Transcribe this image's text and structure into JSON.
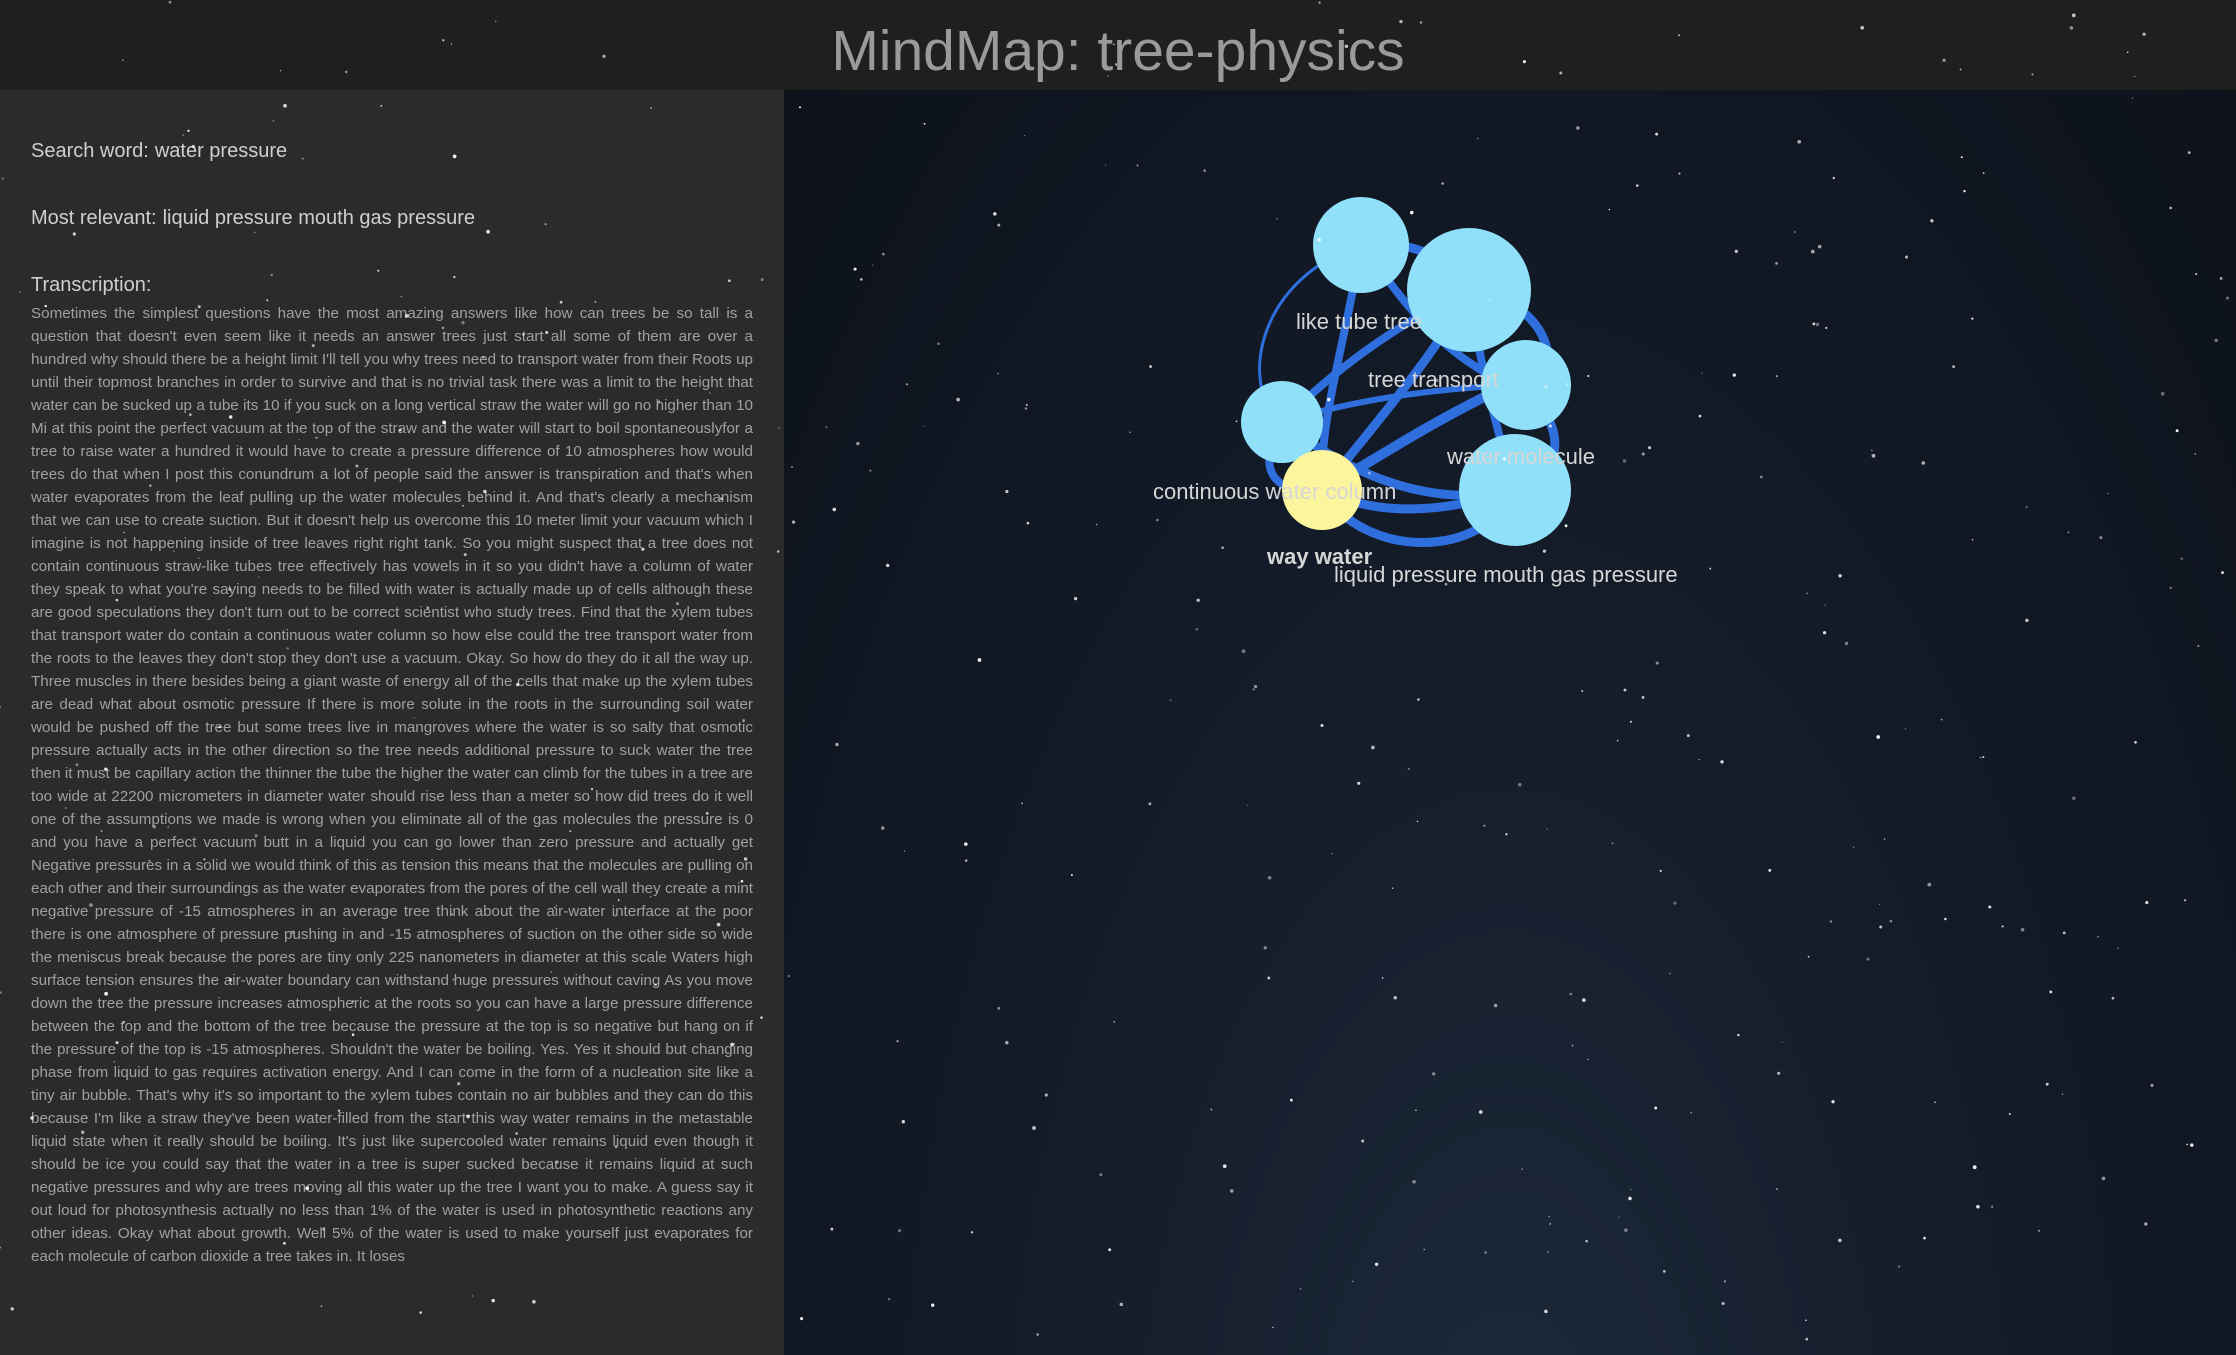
{
  "app": {
    "title": "MindMap: tree-physics"
  },
  "sidebar": {
    "search_label": "Search word:",
    "search_value": "water pressure",
    "relevant_label": "Most relevant:",
    "relevant_value": "liquid pressure mouth gas pressure",
    "transcription_label": "Transcription:",
    "transcription_text": "Sometimes the simplest questions have the most amazing answers like how can trees be so tall is a question that doesn't even seem like it needs an answer trees just start all some of them are over a hundred why should there be a height limit I'll tell you why trees need to transport water from their Roots up until their topmost branches in order to survive and that is no trivial task there was a limit to the height that water can be sucked up a tube its 10 if you suck on a long vertical straw the water will go no higher than 10 Mi at this point the perfect vacuum at the top of the straw and the water will start to boil spontaneouslyfor a tree to raise water a hundred it would have to create a pressure difference of 10 atmospheres how would trees do that when I post this conundrum a lot of people said the answer is transpiration and that's when water evaporates from the leaf pulling up the water molecules behind it. And that's clearly a mechanism that we can use to create suction. But it doesn't help us overcome this 10 meter limit your vacuum which I imagine is not happening inside of tree leaves right right tank. So you might suspect that a tree does not contain continuous straw-like tubes tree effectively has vowels in it so you didn't have a column of water they speak to what you're saying needs to be filled with water is actually made up of cells although these are good speculations they don't turn out to be correct scientist who study trees. Find that the xylem tubes that transport water do contain a continuous water column so how else could the tree transport water from the roots to the leaves they don't stop they don't use a vacuum. Okay. So how do they do it all the way up. Three muscles in there besides being a giant waste of energy all of the cells that make up the xylem tubes are dead what about osmotic pressure If there is more solute in the roots in the surrounding soil water would be pushed off the tree but some trees live in mangroves where the water is so salty that osmotic pressure actually acts in the other direction so the tree needs additional pressure to suck water the tree then it must be capillary action the thinner the tube the higher the water can climb for the tubes in a tree are too wide at 22200 micrometers in diameter water should rise less than a meter so how did trees do it well one of the assumptions we made is wrong when you eliminate all of the gas molecules the pressure is 0 and you have a perfect vacuum butt in a liquid you can go lower than zero pressure and actually get Negative pressures in a solid we would think of this as tension this means that the molecules are pulling on each other and their surroundings as the water evaporates from the pores of the cell wall they create a mint negative pressure of -15 atmospheres in an average tree think about the air-water interface at the poor there is one atmosphere of pressure pushing in and -15 atmospheres of suction on the other side so wide the meniscus break because the pores are tiny only 225 nanometers in diameter at this scale Waters high surface tension ensures the air-water boundary can withstand huge pressures without caving As you move down the tree the pressure increases atmospheric at the roots so you can have a large pressure difference between the top and the bottom of the tree because the pressure at the top is so negative but hang on if the pressure of the top is -15 atmospheres. Shouldn't the water be boiling. Yes. Yes it should but changing phase from liquid to gas requires activation energy. And I can come in the form of a nucleation site like a tiny air bubble. That's why it's so important to the xylem tubes contain no air bubbles and they can do this because I'm like a straw they've been water-filled from the start this way water remains in the metastable liquid state when it really should be boiling. It's just like supercooled water remains liquid even though it should be ice you could say that the water in a tree is super sucked because it remains liquid at such negative pressures and why are trees moving all this water up the tree I want you to make. A guess say it out loud for photosynthesis actually no less than 1% of the water is used in photosynthetic reactions any other ideas. Okay what about growth. Well 5% of the water is used to make yourself just evaporates for each molecule of carbon dioxide a tree takes in. It loses"
  },
  "graph": {
    "nodes": [
      {
        "id": "n-top-left",
        "label": ""
      },
      {
        "id": "n-top-right",
        "label": "like tube tree"
      },
      {
        "id": "n-mid-right",
        "label": "tree transport"
      },
      {
        "id": "n-left",
        "label": ""
      },
      {
        "id": "n-selected",
        "label": "continuous water column"
      },
      {
        "id": "n-bottom-right",
        "label": "water molecule"
      },
      {
        "id": "n-way-water",
        "label": "way water"
      },
      {
        "id": "n-liquid",
        "label": "liquid pressure mouth gas pressure"
      }
    ],
    "colors": {
      "node": "#8fe0f8",
      "selected_node": "#fbf59e",
      "edge": "#2f6fdd"
    }
  }
}
